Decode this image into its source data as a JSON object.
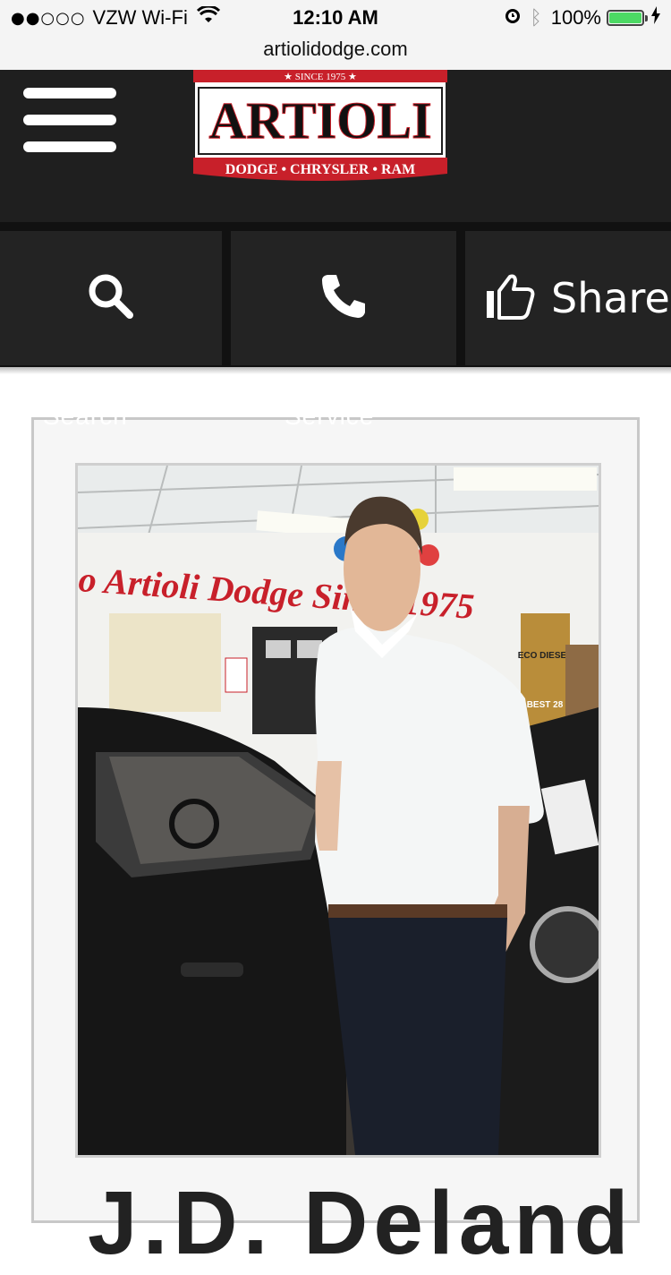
{
  "status_bar": {
    "signal_dots": "●●○○○",
    "carrier": "VZW Wi-Fi",
    "time": "12:10 AM",
    "battery": "100%",
    "battery_level": 1.0
  },
  "browser": {
    "url": "artiolidodge.com"
  },
  "header": {
    "menu_icon": "hamburger-icon",
    "logo": {
      "top_band": "★ SINCE 1975 ★",
      "name": "ARTIOLI",
      "brands": "DODGE • CHRYSLER • RAM"
    }
  },
  "actions": {
    "search_icon": "search-icon",
    "call_icon": "phone-icon",
    "share_icon": "thumbs-up-icon",
    "share_label": "Share"
  },
  "card": {
    "ghost_left": "Search",
    "ghost_right": "Service",
    "photo": {
      "wall_text": "o Artioli Dodge Since 1975",
      "banner_text": "ECO DIESEL",
      "banner_mpg": "BEST 28"
    },
    "name": "J.D. Deland"
  },
  "colors": {
    "header_bg": "#1f1f1f",
    "action_bg": "#232323",
    "logo_red": "#c8202a",
    "battery_green": "#4cd964"
  }
}
